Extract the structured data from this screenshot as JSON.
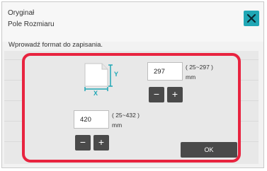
{
  "header": {
    "title_line1": "Oryginał",
    "title_line2": "Pole Rozmiaru",
    "close_icon": "close-icon"
  },
  "instruction": "Wprowadź format do zapisania.",
  "paper": {
    "y_axis_label": "Y",
    "x_axis_label": "X"
  },
  "y_input": {
    "value": "297",
    "range": "( 25~297 )",
    "unit": "mm",
    "minus": "−",
    "plus": "+"
  },
  "x_input": {
    "value": "420",
    "range": "( 25~432 )",
    "unit": "mm",
    "minus": "−",
    "plus": "+"
  },
  "ok_label": "OK",
  "colors": {
    "accent": "#20a7b5",
    "highlight": "#e8233f",
    "button": "#4a4a4a"
  }
}
